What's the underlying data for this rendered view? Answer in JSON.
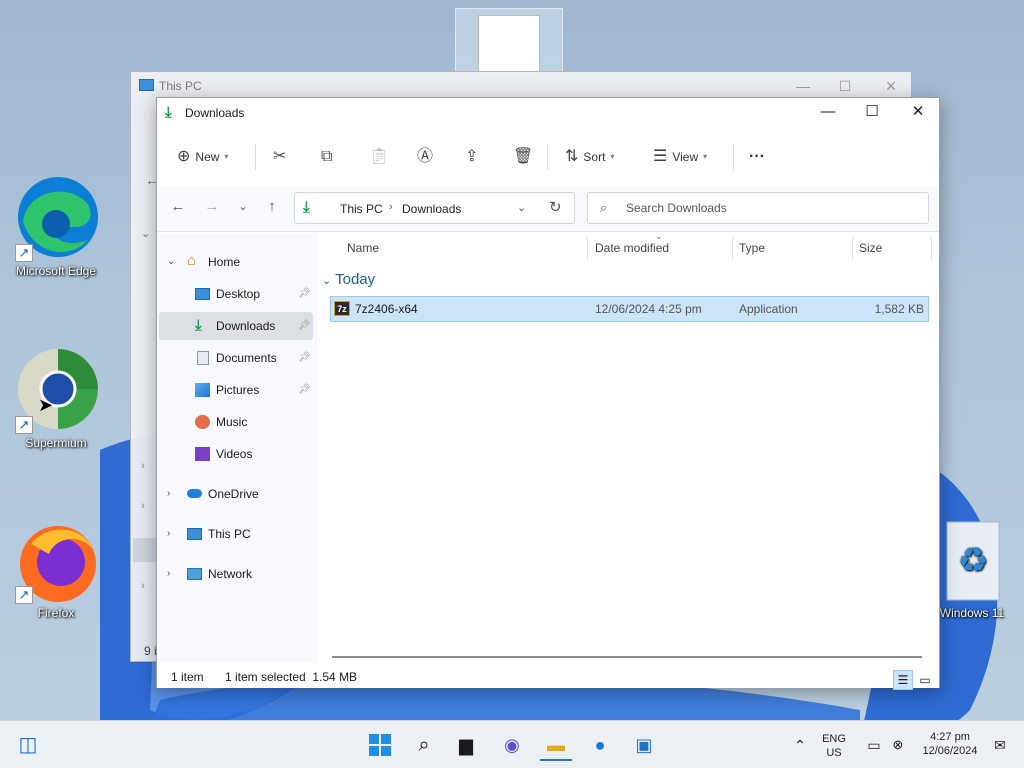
{
  "desktop": {
    "icons": [
      {
        "label": "Microsoft Edge"
      },
      {
        "label": "Supermium"
      },
      {
        "label": "Firefox"
      },
      {
        "label": "Windows 11"
      }
    ]
  },
  "background_window": {
    "title": "This PC",
    "side_fragment": "9 i"
  },
  "window": {
    "title": "Downloads",
    "controls": {
      "minimize": "—",
      "maximize": "☐",
      "close": "✕"
    }
  },
  "toolbar": {
    "new_label": "New",
    "sort_label": "Sort",
    "view_label": "View",
    "more_label": "···"
  },
  "address": {
    "crumbs": [
      "This PC",
      "Downloads"
    ]
  },
  "search": {
    "placeholder": "Search Downloads"
  },
  "sidebar": {
    "home": "Home",
    "items": [
      {
        "label": "Desktop",
        "pinned": true
      },
      {
        "label": "Downloads",
        "pinned": true,
        "selected": true
      },
      {
        "label": "Documents",
        "pinned": true
      },
      {
        "label": "Pictures",
        "pinned": true
      },
      {
        "label": "Music",
        "pinned": false
      },
      {
        "label": "Videos",
        "pinned": false
      }
    ],
    "onedrive": "OneDrive",
    "thispc": "This PC",
    "network": "Network"
  },
  "columns": {
    "name": "Name",
    "date": "Date modified",
    "type": "Type",
    "size": "Size"
  },
  "group_label": "Today",
  "files": [
    {
      "name": "7z2406-x64",
      "date": "12/06/2024 4:25 pm",
      "type": "Application",
      "size": "1,582 KB",
      "icon_text": "7z"
    }
  ],
  "status": {
    "count": "1 item",
    "selected": "1 item selected  1.54 MB"
  },
  "taskbar": {
    "lang_line1": "ENG",
    "lang_line2": "US",
    "time": "4:27 pm",
    "date": "12/06/2024"
  }
}
